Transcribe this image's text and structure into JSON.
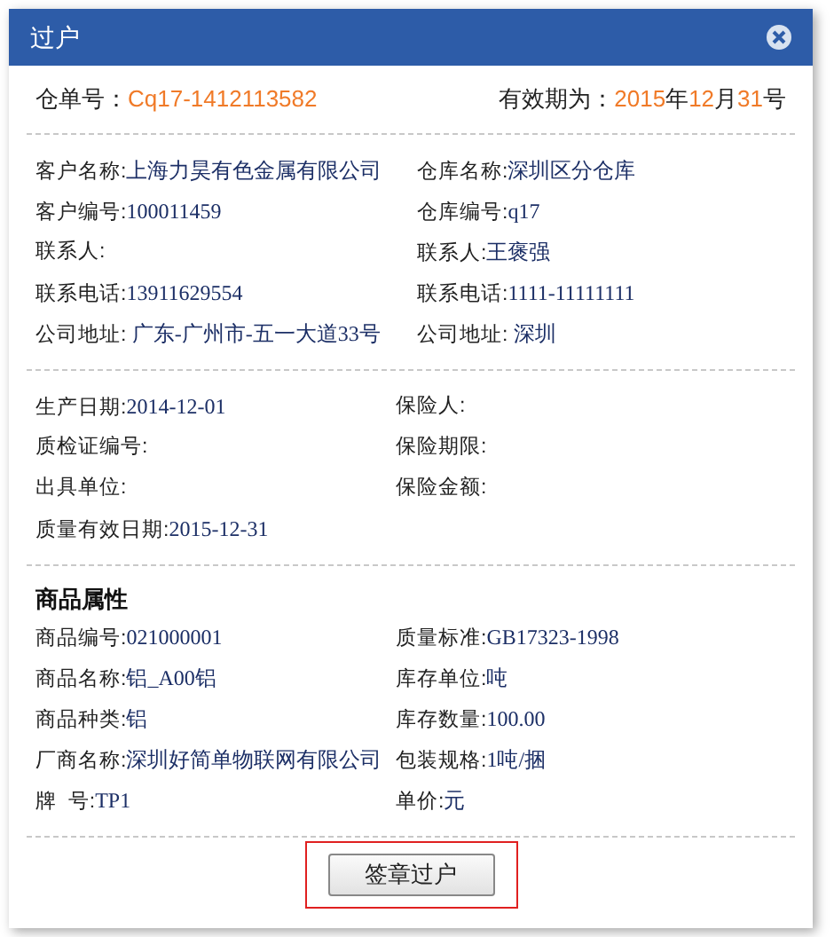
{
  "dialog": {
    "title": "过户"
  },
  "header": {
    "order_label": "仓单号：",
    "order_no": "Cq17-1412113582",
    "validity_label": "有效期为：",
    "year": "2015",
    "year_unit": "年",
    "month": "12",
    "month_unit": "月",
    "day": "31",
    "day_unit": "号"
  },
  "sections": [
    {
      "fields": [
        {
          "label": "客户名称:",
          "value": "上海力昊有色金属有限公司"
        },
        {
          "label": "仓库名称:",
          "value": "深圳区分仓库"
        },
        {
          "label": "客户编号:",
          "value": "100011459"
        },
        {
          "label": "仓库编号:",
          "value": "q17"
        },
        {
          "label": "联系人:"
        },
        {
          "label": "联系人:",
          "value": "王褒强"
        },
        {
          "label": "联系电话:",
          "value": "13911629554"
        },
        {
          "label": "联系电话:",
          "value": "1111-11111111"
        },
        {
          "label": "公司地址: ",
          "value": "广东-广州市-五一大道33号"
        },
        {
          "label": "公司地址: ",
          "value": "深圳"
        }
      ]
    },
    {
      "fields": [
        {
          "label": "生产日期:",
          "value": "2014-12-01"
        },
        {
          "label": "保险人:"
        },
        {
          "label": "质检证编号:"
        },
        {
          "label": "保险期限:"
        },
        {
          "label": "出具单位:"
        },
        {
          "label": "保险金额:"
        },
        {
          "label": "质量有效日期:",
          "value": "2015-12-31"
        }
      ]
    },
    {
      "title": "商品属性",
      "fields": [
        {
          "label": "商品编号:",
          "value": "021000001"
        },
        {
          "label": "质量标准:",
          "value": "GB17323-1998"
        },
        {
          "label": "商品名称:",
          "value": "铝_A00铝"
        },
        {
          "label": "库存单位:",
          "value": "吨"
        },
        {
          "label": "商品种类:",
          "value": "铝"
        },
        {
          "label": "库存数量:",
          "value": "100.00"
        },
        {
          "label": "厂商名称:",
          "value": "深圳好简单物联网有限公司"
        },
        {
          "label": "包装规格:",
          "value": "1吨/捆"
        },
        {
          "label": "牌  号:",
          "value": "TP1"
        },
        {
          "label": "单价:",
          "value": "元"
        }
      ]
    }
  ],
  "button": {
    "label": "签章过户",
    "highlighted": true
  }
}
